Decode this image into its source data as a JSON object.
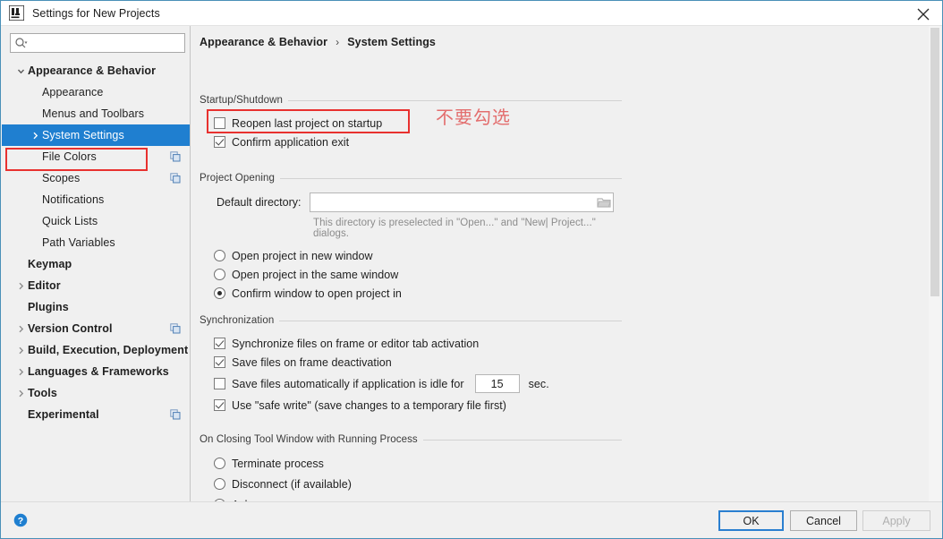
{
  "window": {
    "title": "Settings for New Projects",
    "logo_icon": "intellij-idea-logo",
    "close_icon": "close-icon"
  },
  "sidebar": {
    "search": {
      "placeholder": "",
      "value": "",
      "icon": "search-icon",
      "dropdown_icon": "chevron-down-icon"
    },
    "items": [
      {
        "label": "Appearance & Behavior",
        "indent": 0,
        "twisty": "expanded",
        "bold": true,
        "selected": false,
        "badge": false
      },
      {
        "label": "Appearance",
        "indent": 1,
        "twisty": "none",
        "bold": false,
        "selected": false,
        "badge": false
      },
      {
        "label": "Menus and Toolbars",
        "indent": 1,
        "twisty": "none",
        "bold": false,
        "selected": false,
        "badge": false
      },
      {
        "label": "System Settings",
        "indent": 1,
        "twisty": "collapsed",
        "bold": false,
        "selected": true,
        "badge": false
      },
      {
        "label": "File Colors",
        "indent": 1,
        "twisty": "none",
        "bold": false,
        "selected": false,
        "badge": true
      },
      {
        "label": "Scopes",
        "indent": 1,
        "twisty": "none",
        "bold": false,
        "selected": false,
        "badge": true
      },
      {
        "label": "Notifications",
        "indent": 1,
        "twisty": "none",
        "bold": false,
        "selected": false,
        "badge": false
      },
      {
        "label": "Quick Lists",
        "indent": 1,
        "twisty": "none",
        "bold": false,
        "selected": false,
        "badge": false
      },
      {
        "label": "Path Variables",
        "indent": 1,
        "twisty": "none",
        "bold": false,
        "selected": false,
        "badge": false
      },
      {
        "label": "Keymap",
        "indent": 0,
        "twisty": "none",
        "bold": true,
        "selected": false,
        "badge": false
      },
      {
        "label": "Editor",
        "indent": 0,
        "twisty": "collapsed",
        "bold": true,
        "selected": false,
        "badge": false
      },
      {
        "label": "Plugins",
        "indent": 0,
        "twisty": "none",
        "bold": true,
        "selected": false,
        "badge": false
      },
      {
        "label": "Version Control",
        "indent": 0,
        "twisty": "collapsed",
        "bold": true,
        "selected": false,
        "badge": true
      },
      {
        "label": "Build, Execution, Deployment",
        "indent": 0,
        "twisty": "collapsed",
        "bold": true,
        "selected": false,
        "badge": false
      },
      {
        "label": "Languages & Frameworks",
        "indent": 0,
        "twisty": "collapsed",
        "bold": true,
        "selected": false,
        "badge": false
      },
      {
        "label": "Tools",
        "indent": 0,
        "twisty": "collapsed",
        "bold": true,
        "selected": false,
        "badge": false
      },
      {
        "label": "Experimental",
        "indent": 0,
        "twisty": "none",
        "bold": true,
        "selected": false,
        "badge": true
      }
    ]
  },
  "breadcrumb": {
    "root": "Appearance & Behavior",
    "separator": "›",
    "current": "System Settings"
  },
  "annotations": {
    "note_text": "不要勾选",
    "note_color": "#e36e6e",
    "box_color": "#e8312f"
  },
  "sections": {
    "startup": {
      "title": "Startup/Shutdown",
      "options": [
        {
          "type": "checkbox",
          "label": "Reopen last project on startup",
          "checked": false
        },
        {
          "type": "checkbox",
          "label": "Confirm application exit",
          "checked": true
        }
      ]
    },
    "project_opening": {
      "title": "Project Opening",
      "field_label": "Default directory:",
      "field_value": "",
      "field_placeholder": "",
      "browse_icon": "folder-icon",
      "hint": "This directory is preselected in \"Open...\" and \"New| Project...\" dialogs.",
      "options": [
        {
          "type": "radio",
          "label": "Open project in new window",
          "checked": false
        },
        {
          "type": "radio",
          "label": "Open project in the same window",
          "checked": false
        },
        {
          "type": "radio",
          "label": "Confirm window to open project in",
          "checked": true
        }
      ]
    },
    "synchronization": {
      "title": "Synchronization",
      "options": [
        {
          "type": "checkbox",
          "label": "Synchronize files on frame or editor tab activation",
          "checked": true
        },
        {
          "type": "checkbox",
          "label": "Save files on frame deactivation",
          "checked": true
        },
        {
          "type": "checkbox",
          "label": "Save files automatically if application is idle for",
          "checked": false
        },
        {
          "type": "checkbox",
          "label": "Use \"safe write\" (save changes to a temporary file first)",
          "checked": true
        }
      ],
      "idle_seconds": "15",
      "idle_unit": "sec."
    },
    "closing_tool_window": {
      "title": "On Closing Tool Window with Running Process",
      "options": [
        {
          "type": "radio",
          "label": "Terminate process",
          "checked": false
        },
        {
          "type": "radio",
          "label": "Disconnect (if available)",
          "checked": false
        },
        {
          "type": "radio",
          "label": "Ask",
          "checked": true
        }
      ]
    }
  },
  "footer": {
    "help_icon": "help-icon",
    "ok_label": "OK",
    "cancel_label": "Cancel",
    "apply_label": "Apply",
    "apply_disabled": true
  }
}
